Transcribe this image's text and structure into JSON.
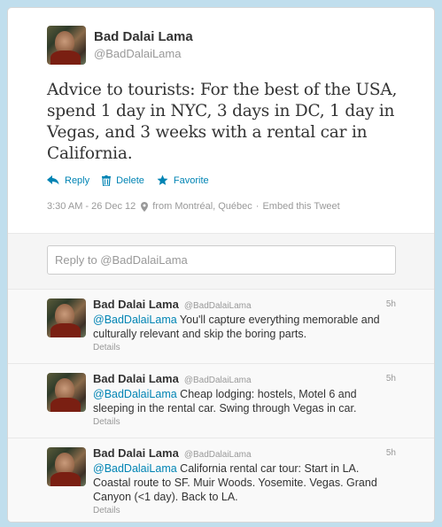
{
  "main_tweet": {
    "name": "Bad Dalai Lama",
    "handle": "@BadDalaiLama",
    "text": "Advice to tourists: For the best of the USA, spend 1 day in NYC, 3 days in DC, 1 day in Vegas, and 3 weeks with a rental car in California.",
    "actions": {
      "reply": "Reply",
      "delete": "Delete",
      "favorite": "Favorite"
    },
    "meta": {
      "timestamp": "3:30 AM - 26 Dec 12",
      "location": "from Montréal, Québec",
      "separator": "·",
      "embed": "Embed this Tweet"
    }
  },
  "reply_box": {
    "placeholder": "Reply to @BadDalaiLama"
  },
  "replies": [
    {
      "name": "Bad Dalai Lama",
      "handle": "@BadDalaiLama",
      "time": "5h",
      "mention": "@BadDalaiLama",
      "text": " You'll capture everything memorable and culturally relevant and skip the boring parts.",
      "details": "Details"
    },
    {
      "name": "Bad Dalai Lama",
      "handle": "@BadDalaiLama",
      "time": "5h",
      "mention": "@BadDalaiLama",
      "text": " Cheap lodging: hostels, Motel 6 and sleeping in the rental car. Swing through Vegas in car.",
      "details": "Details"
    },
    {
      "name": "Bad Dalai Lama",
      "handle": "@BadDalaiLama",
      "time": "5h",
      "mention": "@BadDalaiLama",
      "text": " California rental car tour: Start in LA. Coastal route to SF. Muir Woods. Yosemite. Vegas. Grand Canyon (<1 day). Back to LA.",
      "details": "Details"
    }
  ],
  "colors": {
    "link": "#0084b4",
    "background": "#c0deed",
    "muted": "#999999"
  },
  "icons": {
    "reply": "reply-arrow-icon",
    "delete": "trash-icon",
    "favorite": "star-icon",
    "location": "location-pin-icon"
  }
}
